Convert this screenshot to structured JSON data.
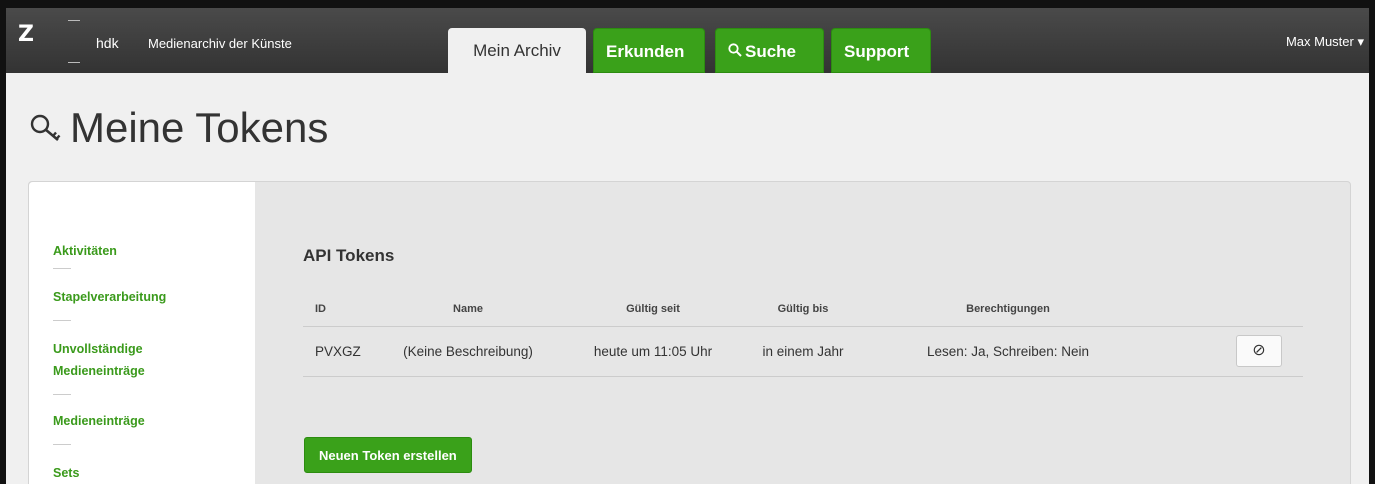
{
  "header": {
    "logo": "Z",
    "brand_short": "hdk",
    "brand_name": "Medienarchiv der Künste",
    "tabs": [
      {
        "label": "Mein Archiv",
        "active": true
      },
      {
        "label": "Erkunden",
        "active": false
      },
      {
        "label": "Suche",
        "active": false,
        "icon": "search-icon"
      },
      {
        "label": "Support",
        "active": false
      }
    ],
    "user": "Max Muster ▾"
  },
  "page": {
    "title": "Meine Tokens",
    "title_icon": "key-icon"
  },
  "sidebar": {
    "items": [
      {
        "label": "Aktivitäten"
      },
      {
        "label": "Stapelverarbeitung"
      },
      {
        "label": "Unvollständige Medieneinträge"
      },
      {
        "label": "Medieneinträge"
      },
      {
        "label": "Sets"
      }
    ]
  },
  "main": {
    "heading": "API Tokens",
    "table": {
      "columns": [
        "ID",
        "Name",
        "Gültig seit",
        "Gültig bis",
        "Berechtigungen"
      ],
      "rows": [
        {
          "id": "PVXGZ",
          "name": "(Keine Beschreibung)",
          "valid_from": "heute um 11:05 Uhr",
          "valid_until": "in einem Jahr",
          "permissions": "Lesen: Ja, Schreiben: Nein",
          "action_icon": "revoke-icon",
          "action_glyph": "⊘"
        }
      ]
    },
    "create_button": "Neuen Token erstellen"
  },
  "colors": {
    "accent_green": "#3aa11a",
    "topbar": "#3c3c3c",
    "background": "#f0f0f0"
  }
}
